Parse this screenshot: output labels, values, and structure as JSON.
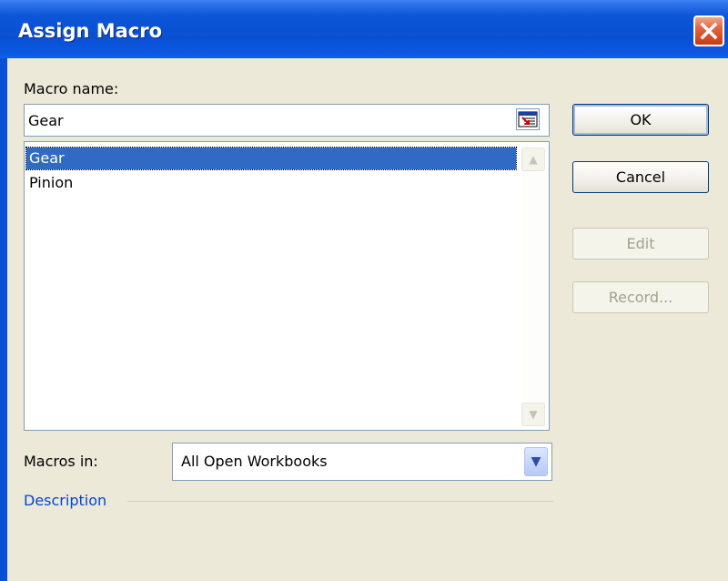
{
  "window": {
    "title": "Assign Macro"
  },
  "macro_name": {
    "label": "Macro name:",
    "value": "Gear"
  },
  "macro_list": {
    "items": [
      "Gear",
      "Pinion"
    ],
    "selected": "Gear"
  },
  "buttons": {
    "ok": "OK",
    "cancel": "Cancel",
    "edit": "Edit",
    "record": "Record..."
  },
  "macros_in": {
    "label": "Macros in:",
    "value": "All Open Workbooks"
  },
  "description": {
    "label": "Description"
  },
  "colors": {
    "titlebar": "#0a50d2",
    "selection": "#316ac5",
    "client": "#ece9d8",
    "description_text": "#0046d5"
  }
}
